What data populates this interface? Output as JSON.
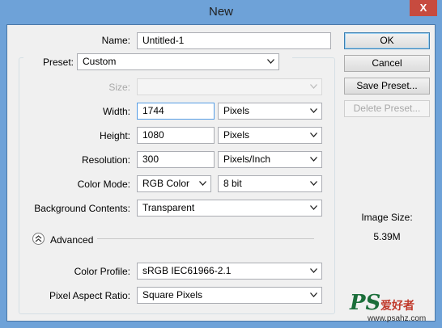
{
  "window": {
    "title": "New",
    "close_label": "X"
  },
  "form": {
    "name_label": "Name:",
    "name_value": "Untitled-1",
    "preset_label": "Preset:",
    "preset_value": "Custom",
    "size_label": "Size:",
    "size_value": "",
    "width_label": "Width:",
    "width_value": "1744",
    "width_unit": "Pixels",
    "height_label": "Height:",
    "height_value": "1080",
    "height_unit": "Pixels",
    "resolution_label": "Resolution:",
    "resolution_value": "300",
    "resolution_unit": "Pixels/Inch",
    "color_mode_label": "Color Mode:",
    "color_mode_value": "RGB Color",
    "bit_depth_value": "8 bit",
    "background_label": "Background Contents:",
    "background_value": "Transparent",
    "advanced_label": "Advanced",
    "color_profile_label": "Color Profile:",
    "color_profile_value": "sRGB IEC61966-2.1",
    "pixel_aspect_label": "Pixel Aspect Ratio:",
    "pixel_aspect_value": "Square Pixels"
  },
  "buttons": {
    "ok": "OK",
    "cancel": "Cancel",
    "save_preset": "Save Preset...",
    "delete_preset": "Delete Preset..."
  },
  "info": {
    "image_size_label": "Image Size:",
    "image_size_value": "5.39M"
  },
  "watermark": {
    "logo": "PS",
    "cn": "爱好者",
    "url": "www.psahz.com"
  }
}
